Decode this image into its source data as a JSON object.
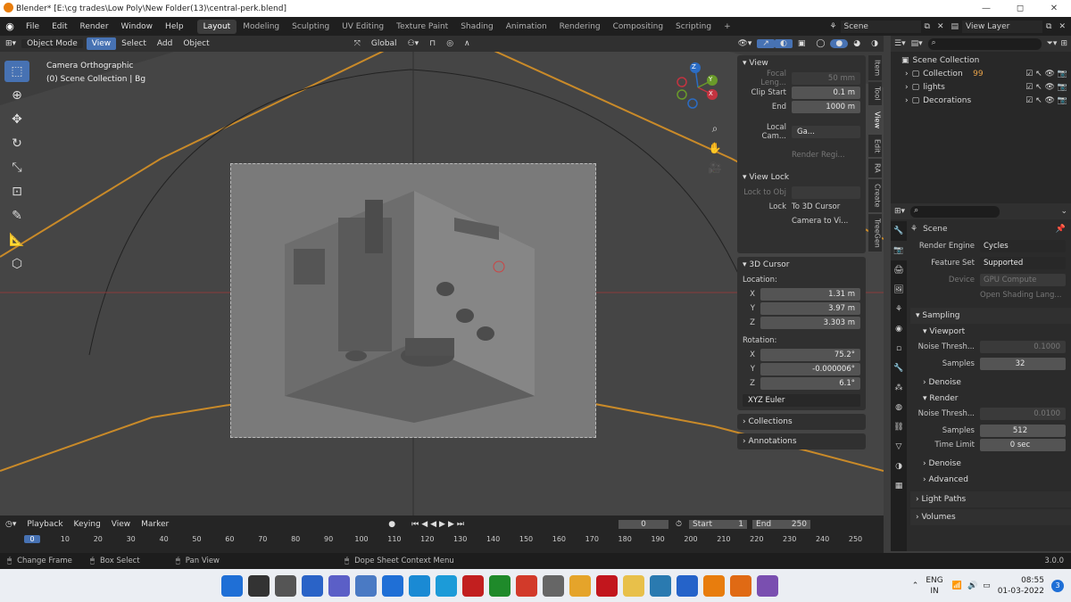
{
  "titlebar": {
    "title": "Blender* [E:\\cg trades\\Low Poly\\New Folder(13)\\central-perk.blend]",
    "min": "—",
    "max": "◻",
    "close": "✕"
  },
  "menu": [
    "File",
    "Edit",
    "Render",
    "Window",
    "Help"
  ],
  "workspaces": [
    "Layout",
    "Modeling",
    "Sculpting",
    "UV Editing",
    "Texture Paint",
    "Shading",
    "Animation",
    "Rendering",
    "Compositing",
    "Scripting"
  ],
  "scene": "Scene",
  "view_layer": "View Layer",
  "vheader": {
    "mode": "Object Mode",
    "view": "View",
    "select": "Select",
    "add": "Add",
    "object": "Object",
    "orientation": "Global"
  },
  "overlay_text": {
    "line1": "Camera Orthographic",
    "line2": "(0) Scene Collection | Bg"
  },
  "gizmo": {
    "x": "X",
    "y": "Y",
    "z": "Z"
  },
  "npanel": {
    "view_header": "View",
    "focal_label": "Focal Leng...",
    "focal": "50 mm",
    "clip_start_label": "Clip Start",
    "clip_start": "0.1 m",
    "end_label": "End",
    "end": "1000 m",
    "local_cam_label": "Local Cam...",
    "local_cam": "Ga...",
    "render_region": "Render Regi...",
    "view_lock_header": "View Lock",
    "lock_to_obj": "Lock to Obj",
    "lock_label": "Lock",
    "to_3d_cursor": "To 3D Cursor",
    "camera_to_view": "Camera to Vi...",
    "cursor_header": "3D Cursor",
    "location_label": "Location:",
    "loc_x": "1.31 m",
    "loc_y": "3.97 m",
    "loc_z": "3.303 m",
    "rotation_label": "Rotation:",
    "rot_x": "75.2°",
    "rot_y": "-0.000006°",
    "rot_z": "6.1°",
    "rot_mode": "XYZ Euler",
    "collections": "Collections",
    "annotations": "Annotations"
  },
  "vtabs": [
    "Item",
    "Tool",
    "View",
    "Edit",
    "RA",
    "Create",
    "TreeGen"
  ],
  "outliner": {
    "root": "Scene Collection",
    "items": [
      "Collection",
      "lights",
      "Decorations"
    ],
    "badge": "99"
  },
  "props": {
    "scene": "Scene",
    "render_engine_label": "Render Engine",
    "render_engine": "Cycles",
    "feature_set_label": "Feature Set",
    "feature_set": "Supported",
    "device_label": "Device",
    "device": "GPU Compute",
    "osl": "Open Shading Lang...",
    "sampling": "Sampling",
    "viewport": "Viewport",
    "noise_label": "Noise Thresh...",
    "vp_noise": "0.1000",
    "samples_label": "Samples",
    "vp_samples": "32",
    "denoise": "Denoise",
    "render": "Render",
    "r_noise": "0.0100",
    "r_samples": "512",
    "time_limit_label": "Time Limit",
    "time_limit": "0 sec",
    "advanced": "Advanced",
    "light_paths": "Light Paths",
    "volumes": "Volumes"
  },
  "timeline": {
    "playback": "Playback",
    "keying": "Keying",
    "view": "View",
    "marker": "Marker",
    "current": "0",
    "start_label": "Start",
    "start": "1",
    "end_label": "End",
    "end": "250",
    "ticks": [
      "0",
      "10",
      "20",
      "30",
      "40",
      "50",
      "60",
      "70",
      "80",
      "90",
      "100",
      "110",
      "120",
      "130",
      "140",
      "150",
      "160",
      "170",
      "180",
      "190",
      "200",
      "210",
      "220",
      "230",
      "240",
      "250"
    ]
  },
  "status": {
    "change_frame": "Change Frame",
    "box_select": "Box Select",
    "pan_view": "Pan View",
    "context": "Dope Sheet Context Menu",
    "version": "3.0.0"
  },
  "taskbar": {
    "lang1": "ENG",
    "lang2": "IN",
    "time": "08:55",
    "date": "01-03-2022",
    "notif": "3"
  }
}
